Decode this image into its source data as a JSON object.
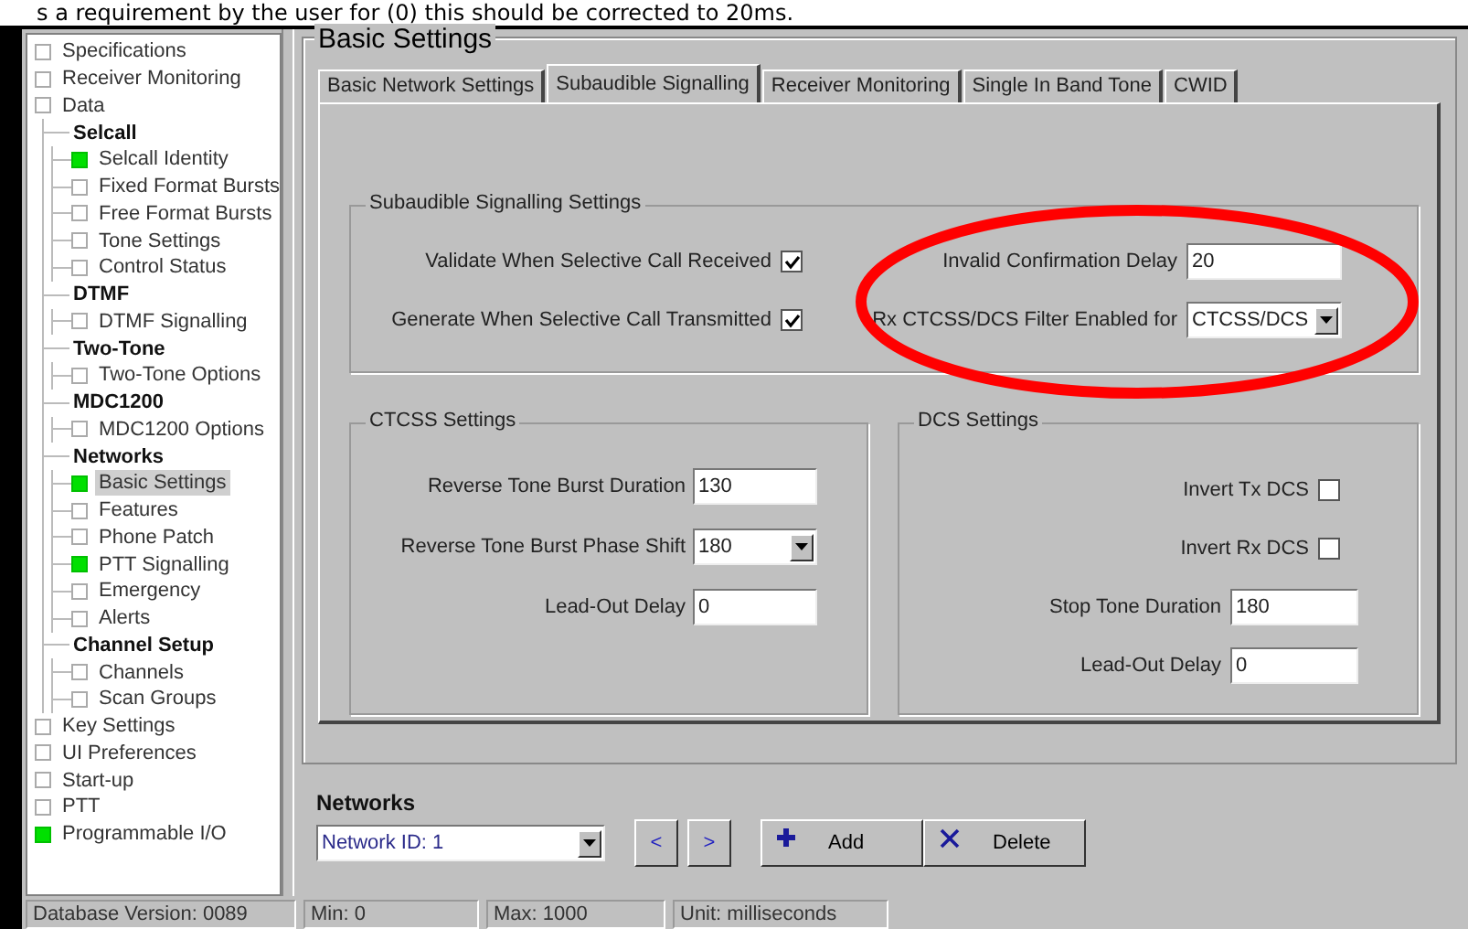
{
  "caption": "s a requirement by the user for (0) this should be corrected to 20ms.",
  "tree": [
    {
      "label": "Specifications",
      "kind": "item",
      "configured": false
    },
    {
      "label": "Receiver Monitoring",
      "kind": "item",
      "configured": false
    },
    {
      "label": "Data",
      "kind": "item",
      "configured": false,
      "children": [
        {
          "label": "Selcall",
          "kind": "group",
          "children": [
            {
              "label": "Selcall Identity",
              "kind": "item",
              "configured": true,
              "selected": false
            },
            {
              "label": "Fixed Format Bursts",
              "kind": "item",
              "configured": false,
              "selected": false
            },
            {
              "label": "Free Format Bursts",
              "kind": "item",
              "configured": false,
              "selected": false
            },
            {
              "label": "Tone Settings",
              "kind": "item",
              "configured": false,
              "selected": false
            },
            {
              "label": "Control Status",
              "kind": "item",
              "configured": false,
              "selected": false
            }
          ]
        },
        {
          "label": "DTMF",
          "kind": "group",
          "children": [
            {
              "label": "DTMF Signalling",
              "kind": "item",
              "configured": false,
              "selected": false
            }
          ]
        },
        {
          "label": "Two-Tone",
          "kind": "group",
          "children": [
            {
              "label": "Two-Tone Options",
              "kind": "item",
              "configured": false,
              "selected": false
            }
          ]
        },
        {
          "label": "MDC1200",
          "kind": "group",
          "children": [
            {
              "label": "MDC1200 Options",
              "kind": "item",
              "configured": false,
              "selected": false
            }
          ]
        },
        {
          "label": "Networks",
          "kind": "group",
          "children": [
            {
              "label": "Basic Settings",
              "kind": "item",
              "configured": true,
              "selected": true
            },
            {
              "label": "Features",
              "kind": "item",
              "configured": false,
              "selected": false
            },
            {
              "label": "Phone Patch",
              "kind": "item",
              "configured": false,
              "selected": false
            },
            {
              "label": "PTT Signalling",
              "kind": "item",
              "configured": true,
              "selected": false
            },
            {
              "label": "Emergency",
              "kind": "item",
              "configured": false,
              "selected": false
            },
            {
              "label": "Alerts",
              "kind": "item",
              "configured": false,
              "selected": false
            }
          ]
        },
        {
          "label": "Channel Setup",
          "kind": "group",
          "children": [
            {
              "label": "Channels",
              "kind": "item",
              "configured": false,
              "selected": false
            },
            {
              "label": "Scan Groups",
              "kind": "item",
              "configured": false,
              "selected": false
            }
          ]
        }
      ]
    },
    {
      "label": "Key Settings",
      "kind": "item",
      "configured": false
    },
    {
      "label": "UI Preferences",
      "kind": "item",
      "configured": false
    },
    {
      "label": "Start-up",
      "kind": "item",
      "configured": false
    },
    {
      "label": "PTT",
      "kind": "item",
      "configured": false
    },
    {
      "label": "Programmable I/O",
      "kind": "item",
      "configured": true
    }
  ],
  "panel": {
    "title": "Basic Settings",
    "tabs": [
      {
        "label": "Basic Network Settings",
        "selected": false
      },
      {
        "label": "Subaudible Signalling",
        "selected": true
      },
      {
        "label": "Receiver Monitoring",
        "selected": false
      },
      {
        "label": "Single In Band Tone",
        "selected": false
      },
      {
        "label": "CWID",
        "selected": false
      }
    ],
    "subaudible": {
      "title": "Subaudible Signalling Settings",
      "left": [
        {
          "kind": "checkbox",
          "label": "Validate When Selective Call Received",
          "checked": true
        },
        {
          "kind": "checkbox",
          "label": "Generate When Selective Call Transmitted",
          "checked": true
        }
      ],
      "right": [
        {
          "kind": "text",
          "label": "Invalid Confirmation Delay",
          "value": "20"
        },
        {
          "kind": "dropdown",
          "label": "Rx CTCSS/DCS Filter Enabled for",
          "value": "CTCSS/DCS"
        }
      ]
    },
    "ctcss": {
      "title": "CTCSS Settings",
      "rows": [
        {
          "kind": "text",
          "label": "Reverse Tone Burst Duration",
          "value": "130"
        },
        {
          "kind": "dropdown",
          "label": "Reverse Tone Burst Phase Shift",
          "value": "180"
        },
        {
          "kind": "text",
          "label": "Lead-Out Delay",
          "value": "0"
        }
      ]
    },
    "dcs": {
      "title": "DCS Settings",
      "rows": [
        {
          "kind": "checkbox",
          "label": "Invert Tx DCS",
          "checked": false
        },
        {
          "kind": "checkbox",
          "label": "Invert Rx DCS",
          "checked": false
        },
        {
          "kind": "text",
          "label": "Stop Tone Duration",
          "value": "180"
        },
        {
          "kind": "text",
          "label": "Lead-Out Delay",
          "value": "0"
        }
      ]
    },
    "annotation": {
      "kind": "ellipse"
    },
    "networks": {
      "label": "Networks",
      "selector": "Network ID: 1",
      "buttons": [
        {
          "kind": "nav",
          "label": "<"
        },
        {
          "kind": "nav",
          "label": ">"
        },
        {
          "kind": "add",
          "label": "Add"
        },
        {
          "kind": "delete",
          "label": "Delete"
        }
      ]
    }
  },
  "status_bar": [
    "Database Version: 0089",
    "Min: 0",
    "Max: 1000",
    "Unit: milliseconds"
  ]
}
